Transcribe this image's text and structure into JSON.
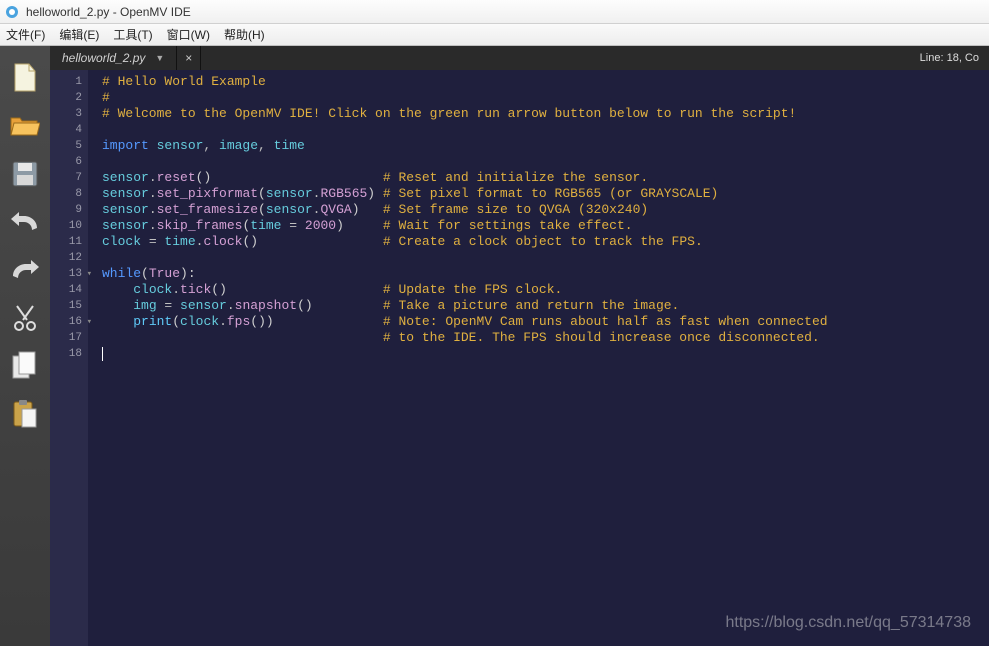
{
  "window": {
    "title": "helloworld_2.py - OpenMV IDE"
  },
  "menus": {
    "file": "文件(F)",
    "edit": "编辑(E)",
    "tools": "工具(T)",
    "window": "窗口(W)",
    "help": "帮助(H)"
  },
  "toolbar": {
    "new_icon": "new-file-icon",
    "open_icon": "open-file-icon",
    "save_icon": "save-icon",
    "undo_icon": "undo-icon",
    "redo_icon": "redo-icon",
    "cut_icon": "cut-icon",
    "copy_icon": "copy-icon",
    "paste_icon": "paste-icon"
  },
  "tab": {
    "filename": "helloworld_2.py",
    "close_glyph": "×"
  },
  "status": {
    "text": "Line: 18, Co"
  },
  "code": {
    "lines": [
      {
        "n": 1,
        "segs": [
          {
            "c": "c-comment",
            "t": "# Hello World Example"
          }
        ]
      },
      {
        "n": 2,
        "segs": [
          {
            "c": "c-comment",
            "t": "#"
          }
        ]
      },
      {
        "n": 3,
        "segs": [
          {
            "c": "c-comment",
            "t": "# Welcome to the OpenMV IDE! Click on the green run arrow button below to run the script!"
          }
        ]
      },
      {
        "n": 4,
        "segs": []
      },
      {
        "n": 5,
        "segs": [
          {
            "c": "c-kw",
            "t": "import "
          },
          {
            "c": "c-mod",
            "t": "sensor"
          },
          {
            "c": "c-op",
            "t": ", "
          },
          {
            "c": "c-mod",
            "t": "image"
          },
          {
            "c": "c-op",
            "t": ", "
          },
          {
            "c": "c-mod",
            "t": "time"
          }
        ]
      },
      {
        "n": 6,
        "segs": []
      },
      {
        "n": 7,
        "segs": [
          {
            "c": "c-mod",
            "t": "sensor"
          },
          {
            "c": "c-op",
            "t": "."
          },
          {
            "c": "c-attr",
            "t": "reset"
          },
          {
            "c": "c-paren",
            "t": "()                      "
          },
          {
            "c": "c-comment",
            "t": "# Reset and initialize the sensor."
          }
        ]
      },
      {
        "n": 8,
        "segs": [
          {
            "c": "c-mod",
            "t": "sensor"
          },
          {
            "c": "c-op",
            "t": "."
          },
          {
            "c": "c-attr",
            "t": "set_pixformat"
          },
          {
            "c": "c-paren",
            "t": "("
          },
          {
            "c": "c-mod",
            "t": "sensor"
          },
          {
            "c": "c-op",
            "t": "."
          },
          {
            "c": "c-attr",
            "t": "RGB565"
          },
          {
            "c": "c-paren",
            "t": ") "
          },
          {
            "c": "c-comment",
            "t": "# Set pixel format to RGB565 (or GRAYSCALE)"
          }
        ]
      },
      {
        "n": 9,
        "segs": [
          {
            "c": "c-mod",
            "t": "sensor"
          },
          {
            "c": "c-op",
            "t": "."
          },
          {
            "c": "c-attr",
            "t": "set_framesize"
          },
          {
            "c": "c-paren",
            "t": "("
          },
          {
            "c": "c-mod",
            "t": "sensor"
          },
          {
            "c": "c-op",
            "t": "."
          },
          {
            "c": "c-attr",
            "t": "QVGA"
          },
          {
            "c": "c-paren",
            "t": ")   "
          },
          {
            "c": "c-comment",
            "t": "# Set frame size to QVGA (320x240)"
          }
        ]
      },
      {
        "n": 10,
        "segs": [
          {
            "c": "c-mod",
            "t": "sensor"
          },
          {
            "c": "c-op",
            "t": "."
          },
          {
            "c": "c-attr",
            "t": "skip_frames"
          },
          {
            "c": "c-paren",
            "t": "("
          },
          {
            "c": "c-mod",
            "t": "time"
          },
          {
            "c": "c-op",
            "t": " = "
          },
          {
            "c": "c-num",
            "t": "2000"
          },
          {
            "c": "c-paren",
            "t": ")     "
          },
          {
            "c": "c-comment",
            "t": "# Wait for settings take effect."
          }
        ]
      },
      {
        "n": 11,
        "segs": [
          {
            "c": "c-mod",
            "t": "clock"
          },
          {
            "c": "c-op",
            "t": " = "
          },
          {
            "c": "c-mod",
            "t": "time"
          },
          {
            "c": "c-op",
            "t": "."
          },
          {
            "c": "c-attr",
            "t": "clock"
          },
          {
            "c": "c-paren",
            "t": "()                "
          },
          {
            "c": "c-comment",
            "t": "# Create a clock object to track the FPS."
          }
        ]
      },
      {
        "n": 12,
        "segs": []
      },
      {
        "n": 13,
        "fold": true,
        "segs": [
          {
            "c": "c-kw",
            "t": "while"
          },
          {
            "c": "c-paren",
            "t": "("
          },
          {
            "c": "c-bool",
            "t": "True"
          },
          {
            "c": "c-paren",
            "t": "):"
          }
        ]
      },
      {
        "n": 14,
        "segs": [
          {
            "c": "",
            "t": "    "
          },
          {
            "c": "c-mod",
            "t": "clock"
          },
          {
            "c": "c-op",
            "t": "."
          },
          {
            "c": "c-attr",
            "t": "tick"
          },
          {
            "c": "c-paren",
            "t": "()                    "
          },
          {
            "c": "c-comment",
            "t": "# Update the FPS clock."
          }
        ]
      },
      {
        "n": 15,
        "segs": [
          {
            "c": "",
            "t": "    "
          },
          {
            "c": "c-mod",
            "t": "img"
          },
          {
            "c": "c-op",
            "t": " = "
          },
          {
            "c": "c-mod",
            "t": "sensor"
          },
          {
            "c": "c-op",
            "t": "."
          },
          {
            "c": "c-attr",
            "t": "snapshot"
          },
          {
            "c": "c-paren",
            "t": "()         "
          },
          {
            "c": "c-comment",
            "t": "# Take a picture and return the image."
          }
        ]
      },
      {
        "n": 16,
        "fold": true,
        "segs": [
          {
            "c": "",
            "t": "    "
          },
          {
            "c": "c-builtin",
            "t": "print"
          },
          {
            "c": "c-paren",
            "t": "("
          },
          {
            "c": "c-mod",
            "t": "clock"
          },
          {
            "c": "c-op",
            "t": "."
          },
          {
            "c": "c-attr",
            "t": "fps"
          },
          {
            "c": "c-paren",
            "t": "())              "
          },
          {
            "c": "c-comment",
            "t": "# Note: OpenMV Cam runs about half as fast when connected"
          }
        ]
      },
      {
        "n": 17,
        "segs": [
          {
            "c": "",
            "t": "                                    "
          },
          {
            "c": "c-comment",
            "t": "# to the IDE. The FPS should increase once disconnected."
          }
        ]
      },
      {
        "n": 18,
        "cursor": true,
        "segs": []
      }
    ]
  },
  "watermark": "https://blog.csdn.net/qq_57314738"
}
